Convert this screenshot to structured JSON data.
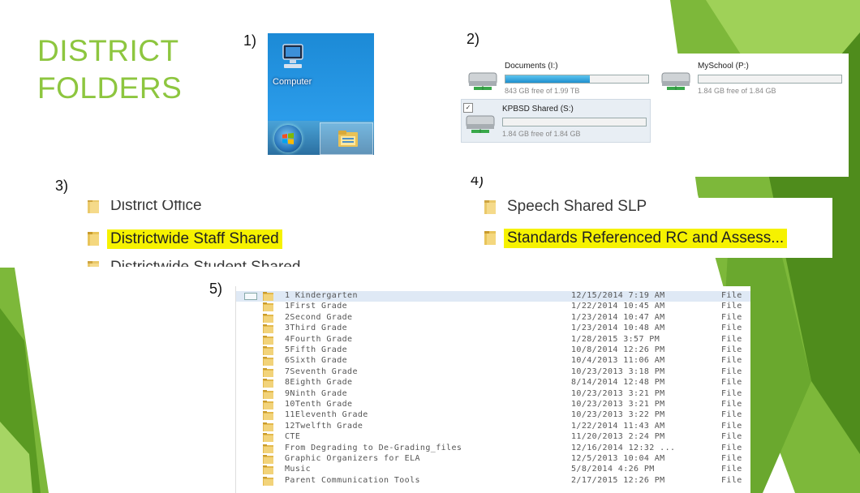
{
  "slide": {
    "title_line1": "DISTRICT",
    "title_line2": "FOLDERS",
    "colors": {
      "accent": "#8dc63f",
      "dark_green": "#5a8f1e",
      "highlight": "#f6f200"
    }
  },
  "step1": {
    "number": "1)",
    "desktop_icon_label": "Computer",
    "icons": [
      "computer-icon",
      "windows-start-icon",
      "file-explorer-icon"
    ]
  },
  "step2": {
    "number": "2)",
    "drives": [
      {
        "name": "Documents (I:)",
        "size": "843 GB free of 1.99 TB",
        "used_fraction": 0.59,
        "icon": "network-drive-icon"
      },
      {
        "name": "MySchool (P:)",
        "size": "1.84 GB free of 1.84 GB",
        "used_fraction": 0.0,
        "icon": "network-drive-icon"
      },
      {
        "name": "KPBSD Shared (S:)",
        "size": "1.84 GB free of 1.84 GB",
        "used_fraction": 0.0,
        "icon": "network-drive-icon",
        "checkbox": "✓"
      }
    ]
  },
  "step3": {
    "number": "3)",
    "rows": [
      "District Office",
      "Districtwide Staff Shared",
      "Districtwide Student Shared"
    ],
    "highlighted_index": 1
  },
  "step4": {
    "number": "4)",
    "rows": [
      "Speech Shared SLP",
      "Standards Referenced RC and Assess..."
    ],
    "highlighted_index": 1
  },
  "step5": {
    "number": "5)",
    "rows": [
      {
        "name": "1 Kindergarten",
        "date": "12/15/2014 7:19 AM",
        "type": "File"
      },
      {
        "name": "1First Grade",
        "date": "1/22/2014 10:45 AM",
        "type": "File"
      },
      {
        "name": "2Second Grade",
        "date": "1/23/2014 10:47 AM",
        "type": "File"
      },
      {
        "name": "3Third Grade",
        "date": "1/23/2014 10:48 AM",
        "type": "File"
      },
      {
        "name": "4Fourth Grade",
        "date": "1/28/2015 3:57 PM",
        "type": "File"
      },
      {
        "name": "5Fifth Grade",
        "date": "10/8/2014 12:26 PM",
        "type": "File"
      },
      {
        "name": "6Sixth Grade",
        "date": "10/4/2013 11:06 AM",
        "type": "File"
      },
      {
        "name": "7Seventh Grade",
        "date": "10/23/2013 3:18 PM",
        "type": "File"
      },
      {
        "name": "8Eighth Grade",
        "date": "8/14/2014 12:48 PM",
        "type": "File"
      },
      {
        "name": "9Ninth Grade",
        "date": "10/23/2013 3:21 PM",
        "type": "File"
      },
      {
        "name": "10Tenth Grade",
        "date": "10/23/2013 3:21 PM",
        "type": "File"
      },
      {
        "name": "11Eleventh Grade",
        "date": "10/23/2013 3:22 PM",
        "type": "File"
      },
      {
        "name": "12Twelfth Grade",
        "date": "1/22/2014 11:43 AM",
        "type": "File"
      },
      {
        "name": "CTE",
        "date": "11/20/2013 2:24 PM",
        "type": "File"
      },
      {
        "name": "From Degrading to De-Grading_files",
        "date": "12/16/2014 12:32 ...",
        "type": "File"
      },
      {
        "name": "Graphic Organizers for ELA",
        "date": "12/5/2013 10:04 AM",
        "type": "File"
      },
      {
        "name": "Music",
        "date": "5/8/2014 4:26 PM",
        "type": "File"
      },
      {
        "name": "Parent Communication Tools",
        "date": "2/17/2015 12:26 PM",
        "type": "File"
      }
    ]
  }
}
